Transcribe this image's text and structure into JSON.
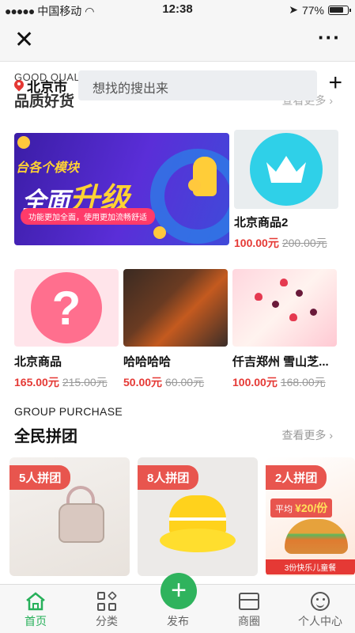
{
  "status_bar": {
    "carrier": "中国移动",
    "time": "12:38",
    "battery": "77%"
  },
  "nav": {
    "close_icon": "close-icon",
    "more_icon": "more-icon"
  },
  "header": {
    "overlay_label": "GOOD QUAL",
    "city": "北京市",
    "search_placeholder": "想找的搜出来",
    "section_title": "品质好货",
    "see_more": "查看更多 ›"
  },
  "banner": {
    "line1": "台各个模块",
    "line2a": "全面",
    "line2b": "升级",
    "pill": "功能更加全面，使用更加流畅舒适"
  },
  "products": [
    {
      "name": "北京商品2",
      "price": "100.00元",
      "old_price": "200.00元",
      "image": "crown"
    },
    {
      "name": "北京商品",
      "price": "165.00元",
      "old_price": "215.00元",
      "image": "question"
    },
    {
      "name": "哈哈哈哈",
      "price": "50.00元",
      "old_price": "60.00元",
      "image": "food"
    },
    {
      "name": "仟吉郑州 雪山芝...",
      "price": "100.00元",
      "old_price": "168.00元",
      "image": "cake"
    }
  ],
  "group": {
    "label_en": "GROUP PURCHASE",
    "title": "全民拼团",
    "see_more": "查看更多 ›",
    "cards": [
      {
        "tag": "5人拼团",
        "image": "handbag"
      },
      {
        "tag": "8人拼团",
        "image": "bucket-hat"
      },
      {
        "tag": "2人拼团",
        "image": "burger",
        "sub_prefix": "平均 ",
        "sub_price": "¥20/份",
        "footer": "3份快乐儿童餐"
      }
    ]
  },
  "tabbar": [
    {
      "label": "首页",
      "icon": "home-icon",
      "active": true
    },
    {
      "label": "分类",
      "icon": "category-icon",
      "active": false
    },
    {
      "label": "发布",
      "icon": "plus-icon",
      "active": false
    },
    {
      "label": "商圈",
      "icon": "store-icon",
      "active": false
    },
    {
      "label": "个人中心",
      "icon": "user-icon",
      "active": false
    }
  ],
  "colors": {
    "accent": "#27b05a",
    "price": "#e53935",
    "tag": "#e8554e"
  }
}
